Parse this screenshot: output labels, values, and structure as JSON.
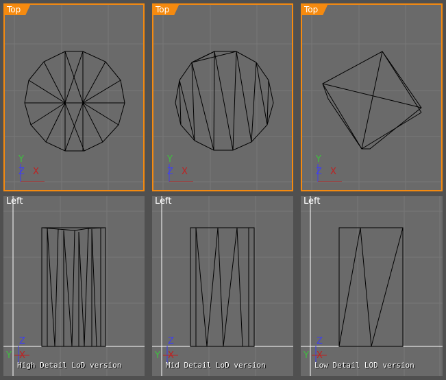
{
  "viewports": {
    "top": [
      {
        "label": "Top",
        "axes": {
          "y": "Y",
          "z": "Z",
          "x": "X"
        }
      },
      {
        "label": "Top",
        "axes": {
          "y": "Y",
          "z": "Z",
          "x": "X"
        }
      },
      {
        "label": "Top",
        "axes": {
          "y": "Y",
          "z": "Z",
          "x": "X"
        }
      }
    ],
    "left": [
      {
        "label": "Left",
        "axes": {
          "y": "Y",
          "z": "Z",
          "x": "X"
        },
        "caption": "High Detail LoD version"
      },
      {
        "label": "Left",
        "axes": {
          "y": "Y",
          "z": "Z",
          "x": "X"
        },
        "caption": "Mid Detail LoD version"
      },
      {
        "label": "Left",
        "axes": {
          "y": "Y",
          "z": "Z",
          "x": "X"
        },
        "caption": "Low Detail LOD version"
      }
    ]
  },
  "colors": {
    "active_border": "#f58a0f",
    "viewport_bg": "#6a6a6a",
    "grid": "#787878",
    "wire": "#000000",
    "axis_y": "#3fbf3f",
    "axis_z": "#3f3fef",
    "axis_x": "#c02020"
  },
  "icons": {
    "gizmo": "axis-gizmo-icon"
  }
}
